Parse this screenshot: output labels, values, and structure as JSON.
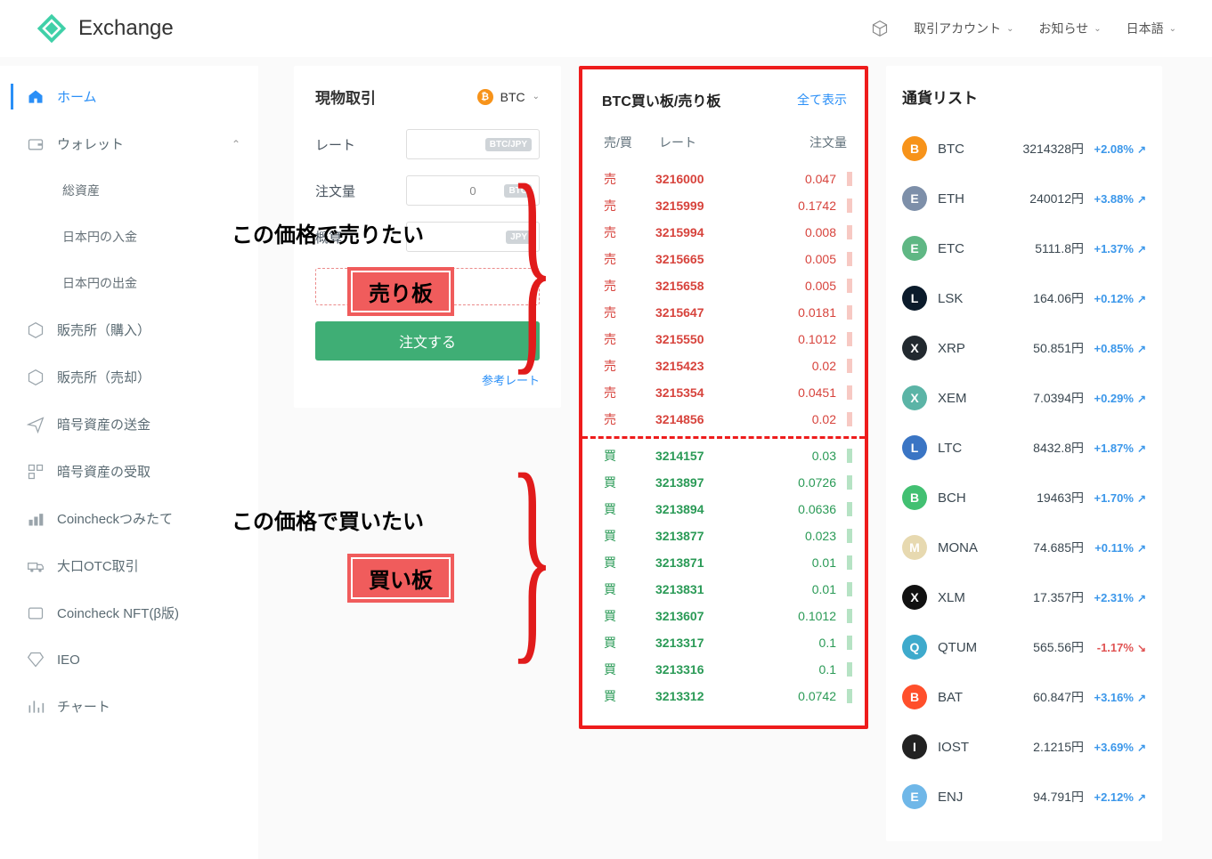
{
  "header": {
    "logo_text": "Exchange",
    "menu_account": "取引アカウント",
    "menu_news": "お知らせ",
    "menu_lang": "日本語"
  },
  "sidebar": {
    "items": [
      {
        "label": "ホーム",
        "active": true,
        "icon": "home"
      },
      {
        "label": "ウォレット",
        "expand": true,
        "icon": "wallet"
      },
      {
        "label": "総資産",
        "sub": true
      },
      {
        "label": "日本円の入金",
        "sub": true
      },
      {
        "label": "日本円の出金",
        "sub": true
      },
      {
        "label": "販売所（購入）",
        "icon": "box"
      },
      {
        "label": "販売所（売却）",
        "icon": "box"
      },
      {
        "label": "暗号資産の送金",
        "icon": "send"
      },
      {
        "label": "暗号資産の受取",
        "icon": "qr"
      },
      {
        "label": "Coincheckつみたて",
        "icon": "blocks"
      },
      {
        "label": "大口OTC取引",
        "icon": "truck"
      },
      {
        "label": "Coincheck NFT(β版)",
        "icon": "card"
      },
      {
        "label": "IEO",
        "icon": "gem"
      },
      {
        "label": "チャート",
        "icon": "chart"
      }
    ]
  },
  "trade": {
    "title": "現物取引",
    "pair": "BTC",
    "rate_label": "レート",
    "rate_unit": "BTC/JPY",
    "qty_label": "注文量",
    "qty_value": "0",
    "qty_unit": "BTC",
    "approx_label": "概算",
    "approx_unit": "JPY",
    "sell_btn": "売り",
    "order_btn": "注文する",
    "ref_rate": "参考レート"
  },
  "annotations": {
    "sell_text": "この価格で売りたい",
    "sell_tag": "売り板",
    "buy_text": "この価格で買いたい",
    "buy_tag": "買い板"
  },
  "orderbook": {
    "title": "BTC買い板/売り板",
    "show_all": "全て表示",
    "col_side": "売/買",
    "col_rate": "レート",
    "col_amount": "注文量",
    "sell_label": "売",
    "buy_label": "買",
    "sells": [
      {
        "rate": "3216000",
        "amount": "0.047"
      },
      {
        "rate": "3215999",
        "amount": "0.1742"
      },
      {
        "rate": "3215994",
        "amount": "0.008"
      },
      {
        "rate": "3215665",
        "amount": "0.005"
      },
      {
        "rate": "3215658",
        "amount": "0.005"
      },
      {
        "rate": "3215647",
        "amount": "0.0181"
      },
      {
        "rate": "3215550",
        "amount": "0.1012"
      },
      {
        "rate": "3215423",
        "amount": "0.02"
      },
      {
        "rate": "3215354",
        "amount": "0.0451"
      },
      {
        "rate": "3214856",
        "amount": "0.02"
      }
    ],
    "buys": [
      {
        "rate": "3214157",
        "amount": "0.03"
      },
      {
        "rate": "3213897",
        "amount": "0.0726"
      },
      {
        "rate": "3213894",
        "amount": "0.0636"
      },
      {
        "rate": "3213877",
        "amount": "0.023"
      },
      {
        "rate": "3213871",
        "amount": "0.01"
      },
      {
        "rate": "3213831",
        "amount": "0.01"
      },
      {
        "rate": "3213607",
        "amount": "0.1012"
      },
      {
        "rate": "3213317",
        "amount": "0.1"
      },
      {
        "rate": "3213316",
        "amount": "0.1"
      },
      {
        "rate": "3213312",
        "amount": "0.0742"
      }
    ]
  },
  "currencies": {
    "title": "通貨リスト",
    "rows": [
      {
        "sym": "BTC",
        "price": "3214328円",
        "change": "+2.08%",
        "dir": "up",
        "bg": "#f7931a"
      },
      {
        "sym": "ETH",
        "price": "240012円",
        "change": "+3.88%",
        "dir": "up",
        "bg": "#7d8fa9"
      },
      {
        "sym": "ETC",
        "price": "5111.8円",
        "change": "+1.37%",
        "dir": "up",
        "bg": "#5fb784"
      },
      {
        "sym": "LSK",
        "price": "164.06円",
        "change": "+0.12%",
        "dir": "up",
        "bg": "#0b1b2b"
      },
      {
        "sym": "XRP",
        "price": "50.851円",
        "change": "+0.85%",
        "dir": "up",
        "bg": "#22292f"
      },
      {
        "sym": "XEM",
        "price": "7.0394円",
        "change": "+0.29%",
        "dir": "up",
        "bg": "#5bb4a6"
      },
      {
        "sym": "LTC",
        "price": "8432.8円",
        "change": "+1.87%",
        "dir": "up",
        "bg": "#3a75c4"
      },
      {
        "sym": "BCH",
        "price": "19463円",
        "change": "+1.70%",
        "dir": "up",
        "bg": "#42c072"
      },
      {
        "sym": "MONA",
        "price": "74.685円",
        "change": "+0.11%",
        "dir": "up",
        "bg": "#e7d9b0"
      },
      {
        "sym": "XLM",
        "price": "17.357円",
        "change": "+2.31%",
        "dir": "up",
        "bg": "#111"
      },
      {
        "sym": "QTUM",
        "price": "565.56円",
        "change": "-1.17%",
        "dir": "down",
        "bg": "#3eaacc"
      },
      {
        "sym": "BAT",
        "price": "60.847円",
        "change": "+3.16%",
        "dir": "up",
        "bg": "#ff4f2b"
      },
      {
        "sym": "IOST",
        "price": "2.1215円",
        "change": "+3.69%",
        "dir": "up",
        "bg": "#222"
      },
      {
        "sym": "ENJ",
        "price": "94.791円",
        "change": "+2.12%",
        "dir": "up",
        "bg": "#6fb7e8"
      }
    ]
  }
}
